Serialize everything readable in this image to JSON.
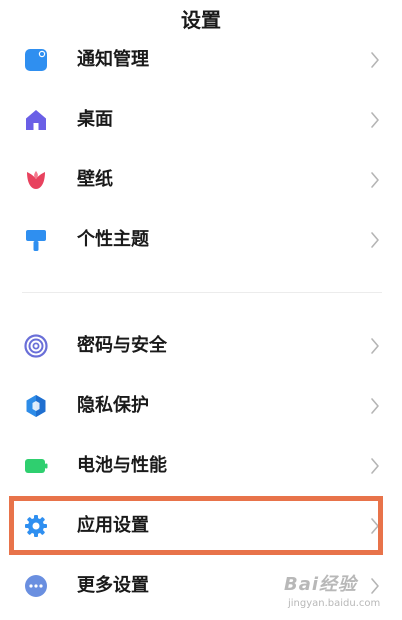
{
  "header": {
    "title": "设置"
  },
  "settings": {
    "items": [
      {
        "label": "通知管理",
        "icon": "notification-icon",
        "color": "#2f8ff0"
      },
      {
        "label": "桌面",
        "icon": "home-icon",
        "color": "#6a5fe6"
      },
      {
        "label": "壁纸",
        "icon": "tulip-icon",
        "color": "#e8425e"
      },
      {
        "label": "个性主题",
        "icon": "paint-brush-icon",
        "color": "#2f8ff0"
      },
      {
        "label": "密码与安全",
        "icon": "fingerprint-icon",
        "color": "#6a6fd8"
      },
      {
        "label": "隐私保护",
        "icon": "privacy-shield-icon",
        "color": "#2d8ce8"
      },
      {
        "label": "电池与性能",
        "icon": "battery-icon",
        "color": "#2fcf6f"
      },
      {
        "label": "应用设置",
        "icon": "gear-icon",
        "color": "#2f8ff0"
      },
      {
        "label": "更多设置",
        "icon": "more-icon",
        "color": "#6a8fe0"
      }
    ]
  },
  "highlight_color": "#e8734a",
  "watermark": {
    "brand": "Bai经验",
    "url": "jingyan.baidu.com"
  }
}
